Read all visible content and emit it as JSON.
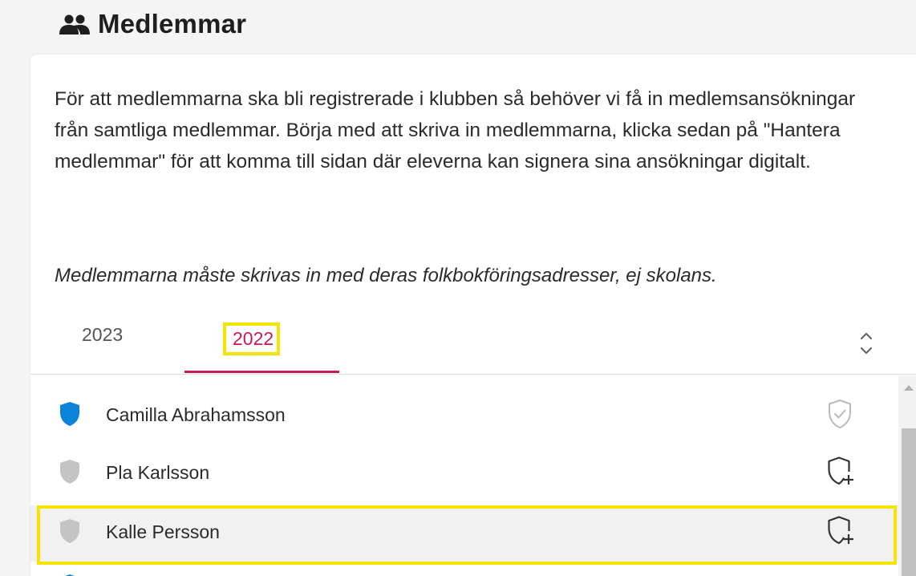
{
  "section": {
    "title": "Medlemmar",
    "icon": "group-icon"
  },
  "card": {
    "intro": "För att medlemmarna ska bli registrerade i klubben så behöver vi få in medlemsansökningar från samtliga medlemmar. Börja med att skriva in medlemmarna, klicka sedan på \"Hantera medlemmar\" för att komma till sidan där eleverna kan signera sina ansökningar digitalt.",
    "note": "Medlemmarna måste skrivas in med deras folkbokföringsadresser, ej skolans."
  },
  "tabs": {
    "items": [
      {
        "label": "2023",
        "active": false
      },
      {
        "label": "2022",
        "active": true
      }
    ],
    "active_color": "#c8185c",
    "toggle_icon": "chevron-up-down-icon"
  },
  "members": [
    {
      "name": "Camilla Abrahamsson",
      "status_icon": "shield-icon",
      "status_color": "#0a84d8",
      "action_icon": "shield-check-icon"
    },
    {
      "name": "Pla Karlsson",
      "status_icon": "shield-icon",
      "status_color": "#c4c4c4",
      "action_icon": "shield-plus-icon"
    },
    {
      "name": "Kalle Persson",
      "status_icon": "shield-icon",
      "status_color": "#c4c4c4",
      "action_icon": "shield-plus-icon"
    }
  ],
  "highlight_color": "#f5e400"
}
